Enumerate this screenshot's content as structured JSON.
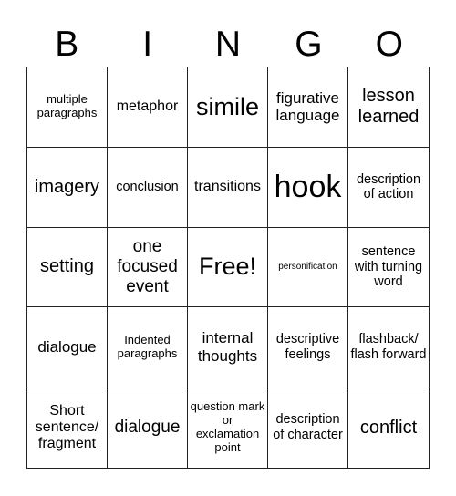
{
  "header": {
    "letters": [
      "B",
      "I",
      "N",
      "G",
      "O"
    ]
  },
  "cells": [
    "multiple paragraphs",
    "metaphor",
    "simile",
    "figurative language",
    "lesson learned",
    "imagery",
    "conclusion",
    "transitions",
    "hook",
    "description of action",
    "setting",
    "one focused event",
    "Free!",
    "personification",
    "sentence with turning word",
    "dialogue",
    "Indented paragraphs",
    "internal thoughts",
    "descriptive feelings",
    "flashback/ flash forward",
    "Short sentence/ fragment",
    "dialogue",
    "question mark or exclamation point",
    "description of character",
    "conflict"
  ]
}
